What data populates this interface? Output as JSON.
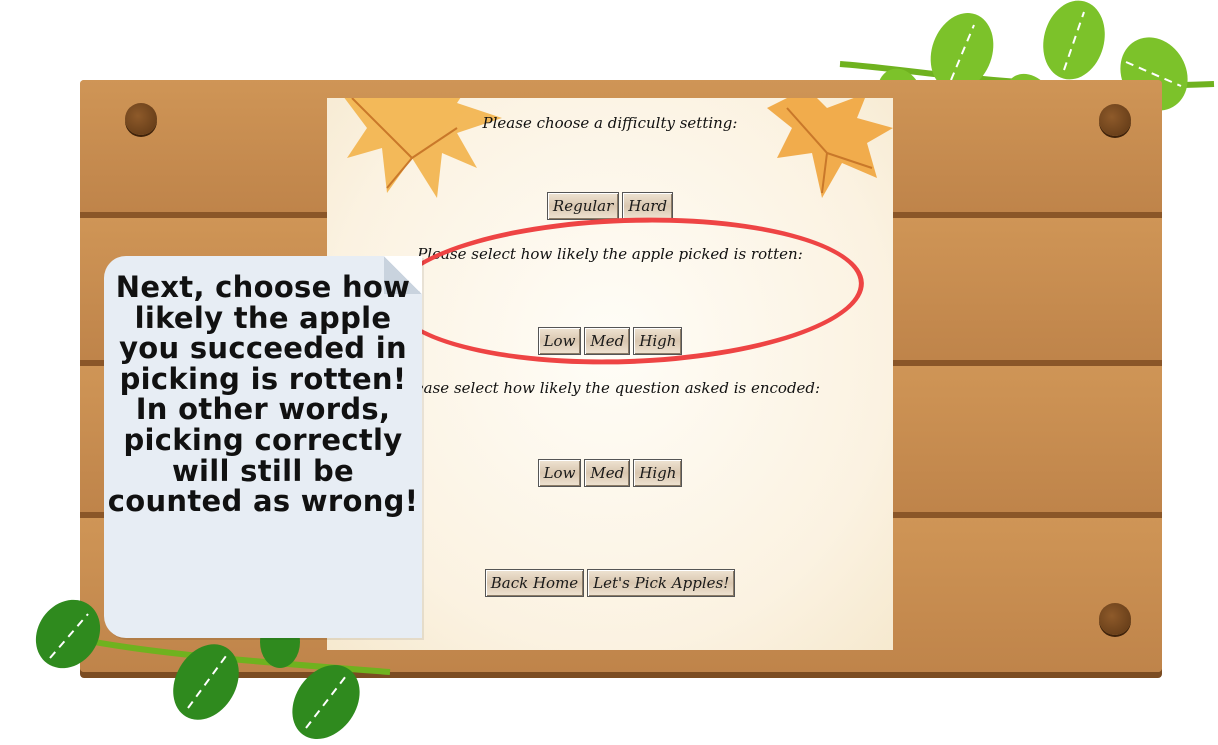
{
  "difficulty": {
    "prompt": "Please choose a difficulty setting:",
    "options": [
      "Regular",
      "Hard"
    ]
  },
  "rotten": {
    "prompt": "Please select how likely the apple picked is rotten:",
    "options": [
      "Low",
      "Med",
      "High"
    ]
  },
  "encoded": {
    "prompt": "Please select how likely the question asked is encoded:",
    "options": [
      "Low",
      "Med",
      "High"
    ]
  },
  "nav": {
    "back_label": "Back Home",
    "start_label": "Let's Pick Apples!"
  },
  "tutorial": {
    "text": "Next, choose how likely the apple you succeeded in picking is rotten! In other words, picking correctly will still be counted as wrong!"
  },
  "colors": {
    "board": "#c2894c",
    "highlight_ring": "#ee4444",
    "leaf_green": "#7cc22a"
  }
}
